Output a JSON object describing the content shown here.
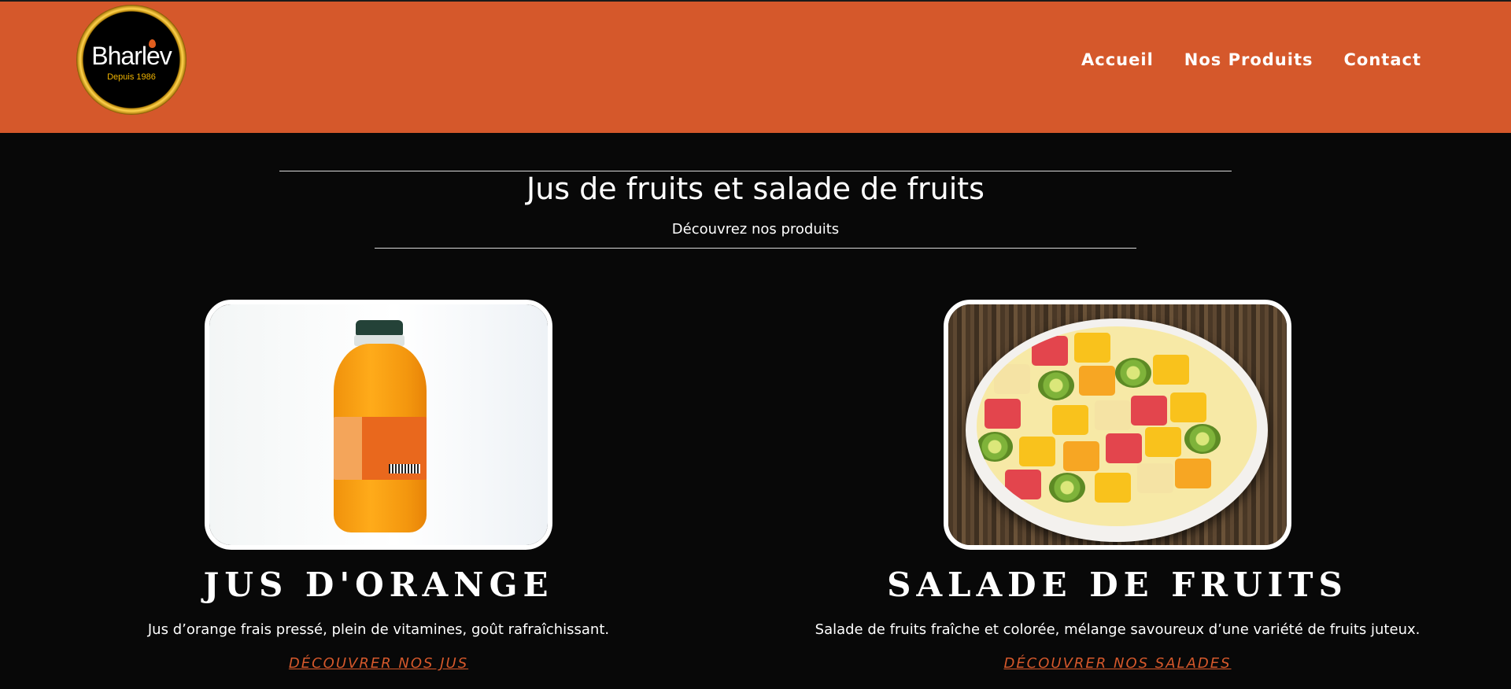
{
  "header": {
    "logo_name": "Bharlev",
    "logo_since": "Depuis 1986",
    "bg_color": "#d5582b"
  },
  "nav": {
    "items": [
      {
        "label": "Accueil"
      },
      {
        "label": "Nos Produits"
      },
      {
        "label": "Contact"
      }
    ]
  },
  "section": {
    "title": "Jus de fruits et salade de fruits",
    "subtitle": "Découvrez nos produits"
  },
  "products": [
    {
      "title": "JUS D'ORANGE",
      "description": "Jus d’orange frais pressé, plein de vitamines, goût rafraîchissant.",
      "link": "DÉCOUVRER NOS JUS",
      "image": "orange-juice-bottle"
    },
    {
      "title": "SALADE DE FRUITS",
      "description": "Salade de fruits fraîche et colorée, mélange savoureux d’une variété de fruits juteux.",
      "link": "DÉCOUVRER NOS SALADES",
      "image": "fruit-salad-bowl"
    }
  ],
  "colors": {
    "accent": "#d5582b",
    "background": "#080808",
    "text": "#ffffff"
  }
}
